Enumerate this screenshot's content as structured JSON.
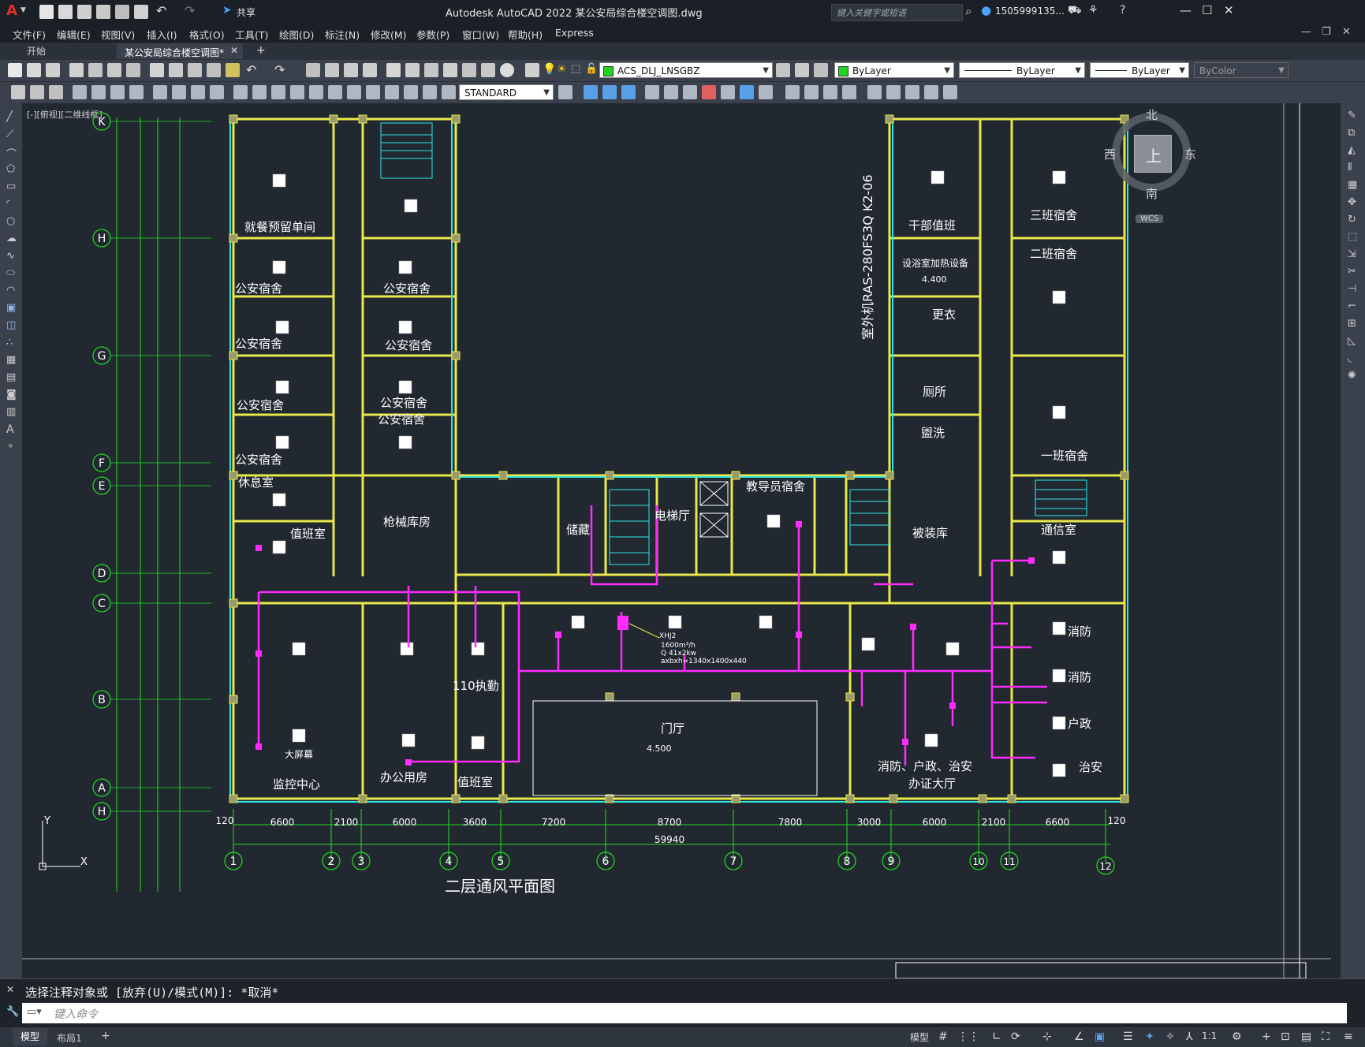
{
  "app": {
    "title": "Autodesk AutoCAD 2022    某公安局综合楼空调图.dwg",
    "search_placeholder": "键入关键字或短语",
    "user": "1505999135...",
    "share": "共享",
    "logo": "A"
  },
  "menu": [
    "文件(F)",
    "编辑(E)",
    "视图(V)",
    "插入(I)",
    "格式(O)",
    "工具(T)",
    "绘图(D)",
    "标注(N)",
    "修改(M)",
    "参数(P)",
    "窗口(W)",
    "帮助(H)",
    "Express"
  ],
  "tabs": {
    "start": "开始",
    "doc": "某公安局综合楼空调图*",
    "add": "+"
  },
  "toolbar": {
    "layer": "ACS_DLJ_LNSGBZ",
    "color": "ByLayer",
    "linetype": "ByLayer",
    "lineweight": "ByLayer",
    "plotstyle": "ByColor",
    "textstyle": "STANDARD"
  },
  "viewport": {
    "label": "[-][俯视][二维线框]",
    "viewcube": {
      "north": "北",
      "south": "南",
      "east": "东",
      "west": "西",
      "top": "上",
      "wcs": "WCS"
    }
  },
  "drawing": {
    "title": "二层通风平面图",
    "ac_unit_label": "室外机RAS-280FS3Q K2-06",
    "fan_label": "XHJ2",
    "fan_spec1": "1600m³/h",
    "fan_spec2": "Q 41x2kw",
    "fan_spec3": "axbxh=1340x1400x440",
    "total_dim": "59940",
    "bottom_dims": [
      "120",
      "6600",
      "2100",
      "6000",
      "3600",
      "7200",
      "8700",
      "7800",
      "3000",
      "6000",
      "2100",
      "6600",
      "120"
    ],
    "grid_bottom": [
      "1",
      "2",
      "3",
      "4",
      "5",
      "6",
      "7",
      "8",
      "9",
      "10",
      "11",
      "12"
    ],
    "grid_left": [
      "K",
      "H",
      "G",
      "F",
      "E",
      "D",
      "C",
      "B",
      "A",
      "H"
    ],
    "rooms": {
      "r1": "就餐预留单间",
      "r2": "公安宿舍",
      "r3": "公安宿舍",
      "r4": "公安宿舍",
      "r5": "公安宿舍",
      "r6": "公安宿舍",
      "r7": "公安宿舍",
      "r8": "公安宿舍",
      "r9": "公安宿舍",
      "r10": "休息室",
      "r11": "值班室",
      "r12": "枪械库房",
      "r13": "储藏",
      "r14": "电梯厅",
      "r15": "教导员宿舍",
      "r16": "被装库",
      "r17": "干部值班",
      "r18": "设浴室加热设备",
      "r19": "更衣",
      "r20": "厕所",
      "r21": "盥洗",
      "r22": "三班宿舍",
      "r23": "二班宿舍",
      "r24": "一班宿舍",
      "r25": "通信室",
      "r26": "消防",
      "r27": "消防",
      "r28": "户政",
      "r29": "治安",
      "r30": "监控中心",
      "r31": "办公用房",
      "r32": "值班室",
      "r33": "110执勤",
      "r34": "门厅",
      "r35": "消防、户政、治安",
      "r36": "办证大厅",
      "r37": "大屏幕"
    },
    "levels": [
      "4.400",
      "4.500"
    ]
  },
  "command": {
    "history": "选择注释对象或 [放弃(U)/模式(M)]: *取消*",
    "placeholder": "键入命令"
  },
  "status": {
    "model_tab": "模型",
    "layout_tab": "布局1",
    "model": "模型",
    "scale": "1:1"
  }
}
